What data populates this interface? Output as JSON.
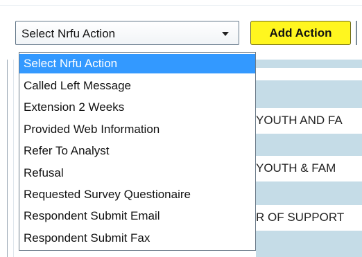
{
  "action_select": {
    "value": "Select Nrfu Action",
    "options": [
      "Select Nrfu Action",
      "Called Left Message",
      "Extension 2 Weeks",
      "Provided Web Information",
      "Refer To Analyst",
      "Refusal",
      "Requested Survey Questionaire",
      "Respondent Submit Email",
      "Respondent Submit Fax"
    ],
    "selected_index": 0
  },
  "add_action_label": "Add Action",
  "background_rows": [
    "YOUTH AND FA",
    "YOUTH & FAM",
    "R OF SUPPORT"
  ],
  "colors": {
    "highlight": "#3399ff",
    "button": "#fff61f",
    "band": "#c5dce7"
  }
}
